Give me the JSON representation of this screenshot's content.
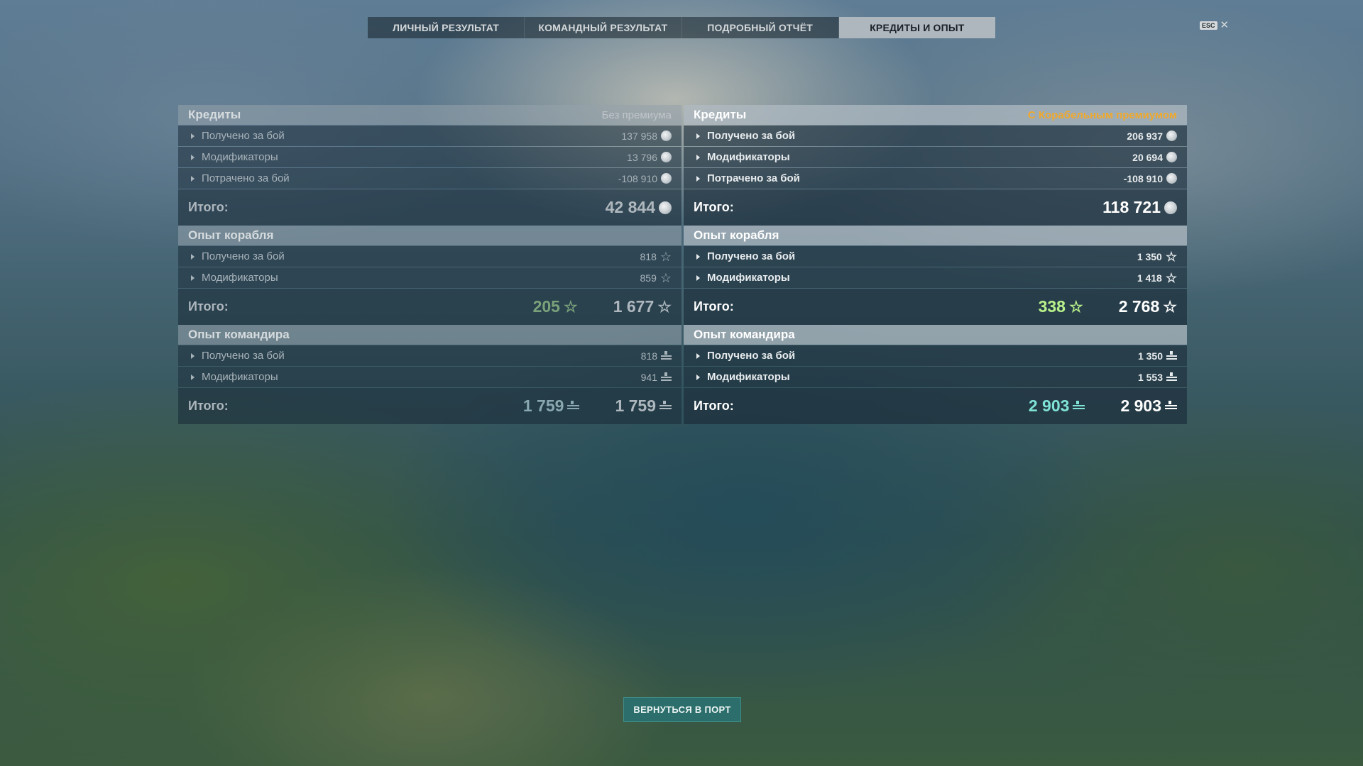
{
  "tabs": [
    {
      "label": "ЛИЧНЫЙ РЕЗУЛЬТАТ"
    },
    {
      "label": "КОМАНДНЫЙ РЕЗУЛЬТАТ"
    },
    {
      "label": "ПОДРОБНЫЙ ОТЧЁТ"
    },
    {
      "label": "КРЕДИТЫ И ОПЫТ",
      "active": true
    }
  ],
  "esc": {
    "key": "ESC",
    "close": "✕"
  },
  "left": {
    "credits": {
      "title": "Кредиты",
      "note": "Без премиума",
      "rows": [
        {
          "label": "Получено за бой",
          "value": "137 958"
        },
        {
          "label": "Модификаторы",
          "value": "13 796"
        },
        {
          "label": "Потрачено за бой",
          "value": "-108 910"
        }
      ],
      "total_label": "Итого:",
      "total": "42 844"
    },
    "ship_xp": {
      "title": "Опыт корабля",
      "rows": [
        {
          "label": "Получено за бой",
          "value": "818"
        },
        {
          "label": "Модификаторы",
          "value": "859"
        }
      ],
      "total_label": "Итого:",
      "free": "205",
      "total": "1 677"
    },
    "cmdr_xp": {
      "title": "Опыт командира",
      "rows": [
        {
          "label": "Получено за бой",
          "value": "818"
        },
        {
          "label": "Модификаторы",
          "value": "941"
        }
      ],
      "total_label": "Итого:",
      "free": "1 759",
      "total": "1 759"
    }
  },
  "right": {
    "credits": {
      "title": "Кредиты",
      "note": "С Корабельным премиумом",
      "rows": [
        {
          "label": "Получено за бой",
          "value": "206 937"
        },
        {
          "label": "Модификаторы",
          "value": "20 694"
        },
        {
          "label": "Потрачено за бой",
          "value": "-108 910"
        }
      ],
      "total_label": "Итого:",
      "total": "118 721"
    },
    "ship_xp": {
      "title": "Опыт корабля",
      "rows": [
        {
          "label": "Получено за бой",
          "value": "1 350"
        },
        {
          "label": "Модификаторы",
          "value": "1 418"
        }
      ],
      "total_label": "Итого:",
      "free": "338",
      "total": "2 768"
    },
    "cmdr_xp": {
      "title": "Опыт командира",
      "rows": [
        {
          "label": "Получено за бой",
          "value": "1 350"
        },
        {
          "label": "Модификаторы",
          "value": "1 553"
        }
      ],
      "total_label": "Итого:",
      "free": "2 903",
      "total": "2 903"
    }
  },
  "icons": {
    "credit": "credit-coin-icon",
    "xp": "xp-star-icon",
    "cmdr": "commander-xp-icon"
  },
  "colors": {
    "premium_note": "#f0a92c",
    "free_xp_premium": "#b9f28b",
    "cmdr_xp_premium": "#7fe3d6",
    "button": "#2b6e6b"
  },
  "port_button": "ВЕРНУТЬСЯ В ПОРТ"
}
